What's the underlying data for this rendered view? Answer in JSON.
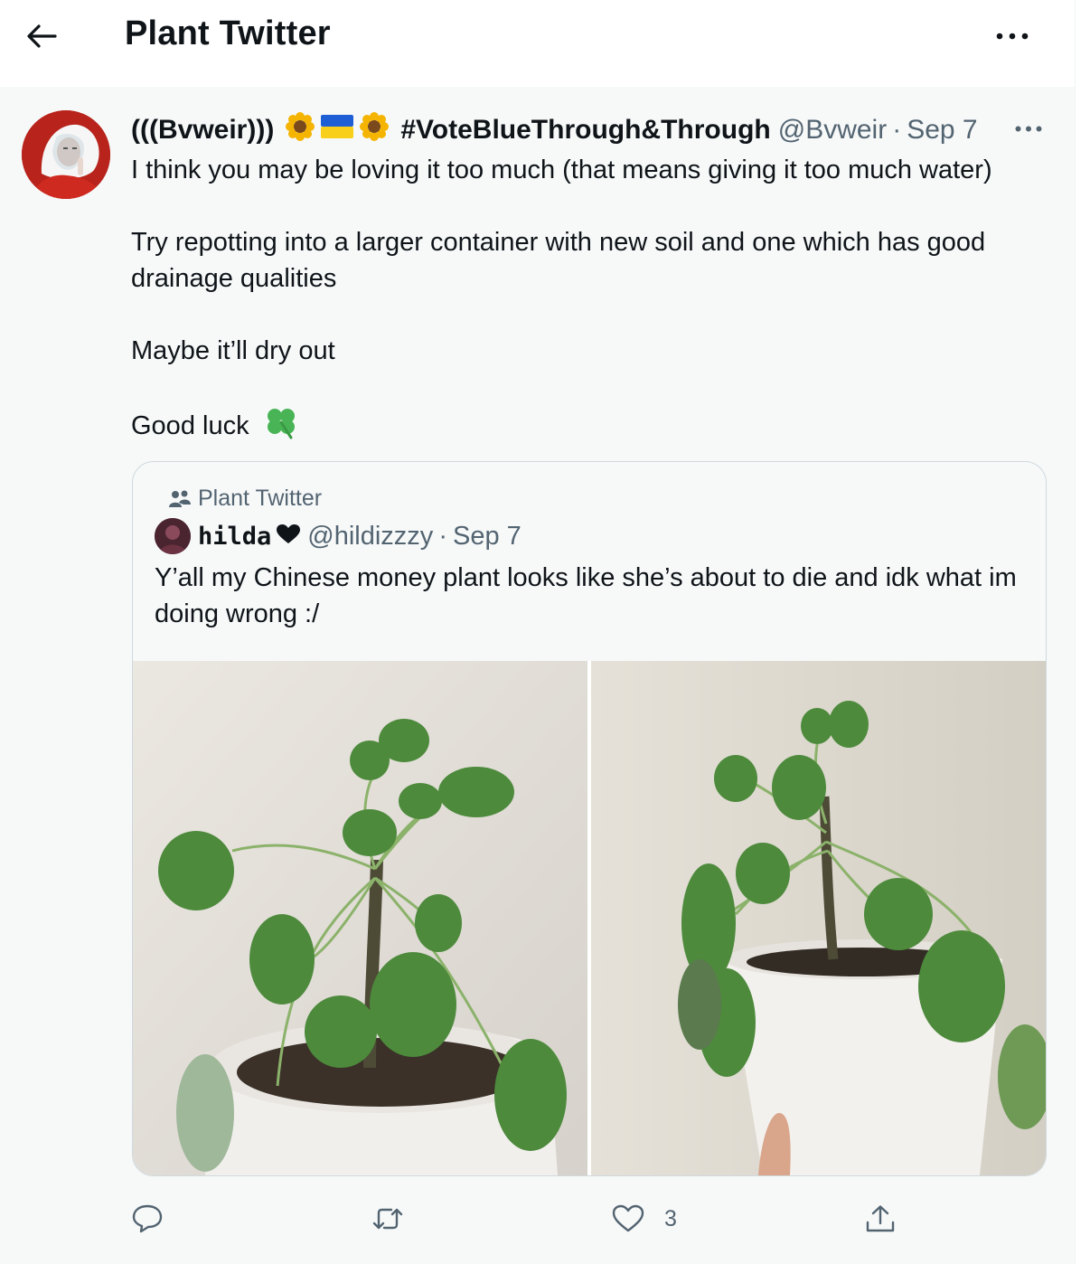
{
  "header": {
    "title": "Plant Twitter"
  },
  "tweet": {
    "display_name": "(((Bvweir)))",
    "hashtag": "#VoteBlueThrough&Through",
    "handle": "@Bvweir",
    "separator": "·",
    "date": "Sep 7",
    "paragraphs": [
      "I think you may be loving it too much (that means giving it too much water)",
      "Try repotting into a larger container with new soil and one which has good drainage qualities",
      "Maybe it’ll dry out",
      "Good luck"
    ],
    "name_icons": [
      "sunflower-emoji",
      "ukraine-flag-emoji",
      "sunflower-emoji"
    ],
    "end_icon": "four-leaf-clover-emoji"
  },
  "quote": {
    "community": "Plant Twitter",
    "display_name": "hilda",
    "handle": "@hildizzzy",
    "separator": "·",
    "date": "Sep 7",
    "text": "Y’all my Chinese money plant looks like she’s about to die and idk what im doing wrong :/"
  },
  "actions": {
    "reply_count": "",
    "retweet_count": "",
    "like_count": "3"
  },
  "colors": {
    "text": "#0f1419",
    "secondary": "#536471",
    "tweet_background": "#f7f9f9",
    "border": "#cfd9de"
  }
}
